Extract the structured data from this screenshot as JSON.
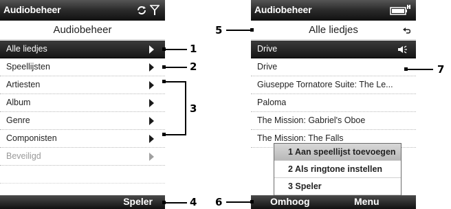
{
  "left_screen": {
    "title": "Audiobeheer",
    "header": "Audiobeheer",
    "items": [
      {
        "label": "Alle liedjes"
      },
      {
        "label": "Speellijsten"
      },
      {
        "label": "Artiesten"
      },
      {
        "label": "Album"
      },
      {
        "label": "Genre"
      },
      {
        "label": "Componisten"
      },
      {
        "label": "Beveiligd"
      }
    ],
    "softkey_right": "Speler"
  },
  "right_screen": {
    "title": "Audiobeheer",
    "header": "Alle liedjes",
    "songs": [
      {
        "label": "Drive"
      },
      {
        "label": "Drive"
      },
      {
        "label": "Giuseppe Tornatore Suite: The Le..."
      },
      {
        "label": "Paloma"
      },
      {
        "label": "The Mission: Gabriel's Oboe"
      },
      {
        "label": "The Mission: The Falls"
      }
    ],
    "softkey_left": "Omhoog",
    "softkey_right": "Menu",
    "menu": [
      {
        "label": "1 Aan speellijst toevoegen"
      },
      {
        "label": "2 Als ringtone instellen"
      },
      {
        "label": "3 Speler"
      }
    ]
  },
  "callouts": [
    "1",
    "2",
    "3",
    "4",
    "5",
    "6",
    "7"
  ],
  "icons": {
    "left_status": [
      "connectivity-icon",
      "signal-icon"
    ],
    "right_status": [
      "battery-icon"
    ],
    "selected_item": "chevron-right-icon",
    "now_playing": "speaker-icon",
    "header_action": "back-icon"
  }
}
